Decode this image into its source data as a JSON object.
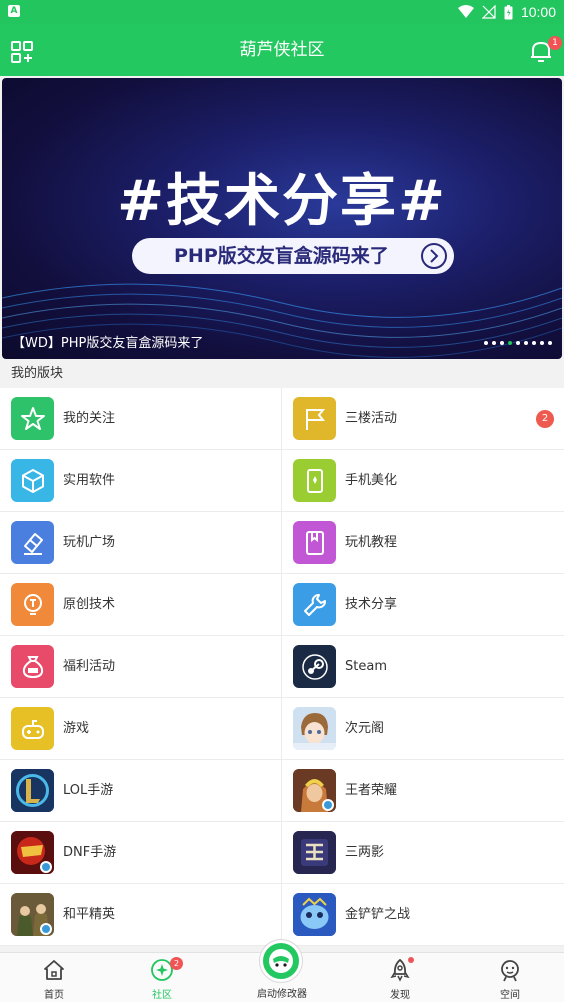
{
  "status_bar": {
    "time": "10:00"
  },
  "header": {
    "title": "葫芦侠社区",
    "notification_count": "1"
  },
  "banner": {
    "headline": "#技术分享#",
    "pill_text": "PHP版交友盲盒源码来了",
    "caption": "【WD】PHP版交友盲盒源码来了",
    "dots_total": 9,
    "dots_active_index": 3
  },
  "section": {
    "title": "我的版块"
  },
  "boards": [
    [
      {
        "label": "我的关注",
        "icon": "star-icon",
        "color": "#2ec26a"
      },
      {
        "label": "三楼活动",
        "icon": "flag-icon",
        "color": "#e0b72a",
        "badge": "2"
      }
    ],
    [
      {
        "label": "实用软件",
        "icon": "cube-icon",
        "color": "#38b6e6"
      },
      {
        "label": "手机美化",
        "icon": "phone-icon",
        "color": "#9acd32"
      }
    ],
    [
      {
        "label": "玩机广场",
        "icon": "eraser-icon",
        "color": "#4a7fe0"
      },
      {
        "label": "玩机教程",
        "icon": "book-icon",
        "color": "#c257d6"
      }
    ],
    [
      {
        "label": "原创技术",
        "icon": "bulb-icon",
        "color": "#f08a3a"
      },
      {
        "label": "技术分享",
        "icon": "wrench-icon",
        "color": "#3a9de6"
      }
    ],
    [
      {
        "label": "福利活动",
        "icon": "moneybag-icon",
        "color": "#e84a6a"
      },
      {
        "label": "Steam",
        "icon": "steam-icon",
        "color": "#1a2a44"
      }
    ],
    [
      {
        "label": "游戏",
        "icon": "gamepad-icon",
        "color": "#e6c024"
      },
      {
        "label": "次元阁",
        "icon": "anime-avatar-icon",
        "color": "#c9d7e8"
      }
    ],
    [
      {
        "label": "LOL手游",
        "icon": "lol-logo-icon",
        "color": "#1d3c6e"
      },
      {
        "label": "王者荣耀",
        "icon": "honor-of-kings-icon",
        "color": "#8a4a2a"
      }
    ],
    [
      {
        "label": "DNF手游",
        "icon": "dnf-logo-icon",
        "color": "#8a1a1a"
      },
      {
        "label": "三两影",
        "icon": "sanliangying-icon",
        "color": "#2a2a5a"
      }
    ],
    [
      {
        "label": "和平精英",
        "icon": "peace-elite-icon",
        "color": "#8a7a4a"
      },
      {
        "label": "金铲铲之战",
        "icon": "tft-mobile-icon",
        "color": "#3a6ad0"
      }
    ]
  ],
  "tabbar": {
    "home": "首页",
    "community": "社区",
    "community_badge": "2",
    "launcher": "启动修改器",
    "discover": "发现",
    "space": "空间"
  }
}
